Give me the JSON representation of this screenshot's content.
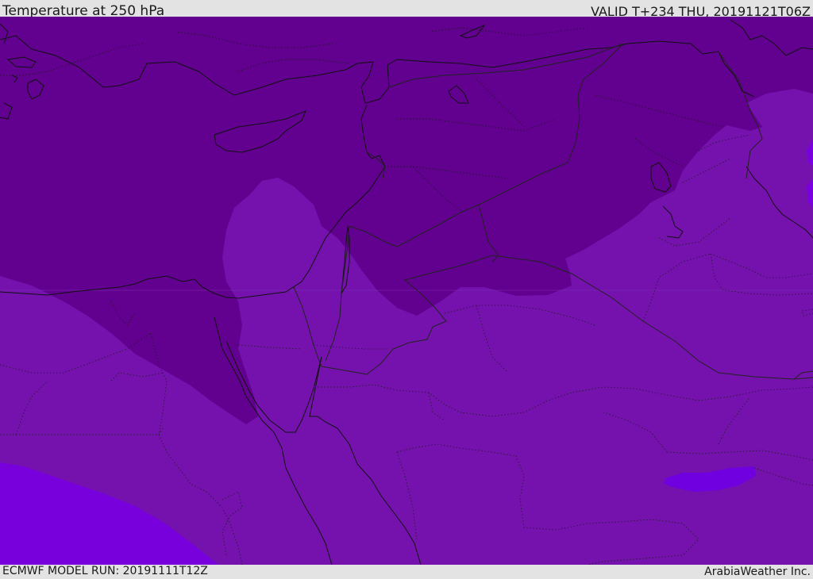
{
  "header": {
    "title": "Temperature at 250 hPa",
    "valid_time": "VALID T+234 THU, 20191121T06Z"
  },
  "footer": {
    "model_run": "ECMWF MODEL RUN: 20191111T12Z",
    "credit": "ArabiaWeather Inc."
  },
  "colors": {
    "dark_band": "#62008f",
    "mid_band": "#7512ad",
    "light_band": "#7700dd",
    "small_blob": "#7000e0",
    "coastline": "#111111",
    "border": "#222222"
  }
}
